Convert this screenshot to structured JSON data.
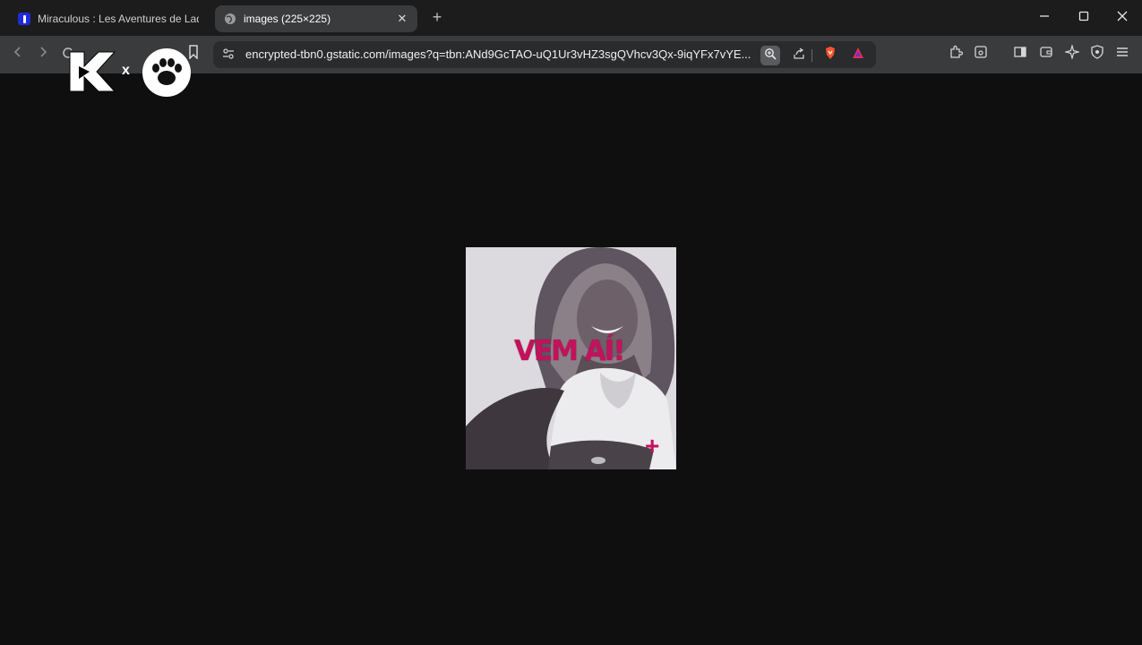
{
  "tabs": [
    {
      "title": "Miraculous : Les Aventures de Ladyb",
      "active": false,
      "favicon": "miraculous-favicon"
    },
    {
      "title": "images (225×225)",
      "active": true,
      "favicon": "globe-icon"
    }
  ],
  "address_bar": {
    "url": "encrypted-tbn0.gstatic.com/images?q=tbn:ANd9GcTAO-uQ1Ur3vHZ3sgQVhcv3Qx-9iqYFx7vYE..."
  },
  "overlay": {
    "separator": "x"
  },
  "image": {
    "caption": "VEM AÍ!",
    "plus": "+"
  },
  "colors": {
    "accent_magenta": "#c2125c",
    "brave_orange": "#fb542b",
    "background": "#0f0f10"
  }
}
